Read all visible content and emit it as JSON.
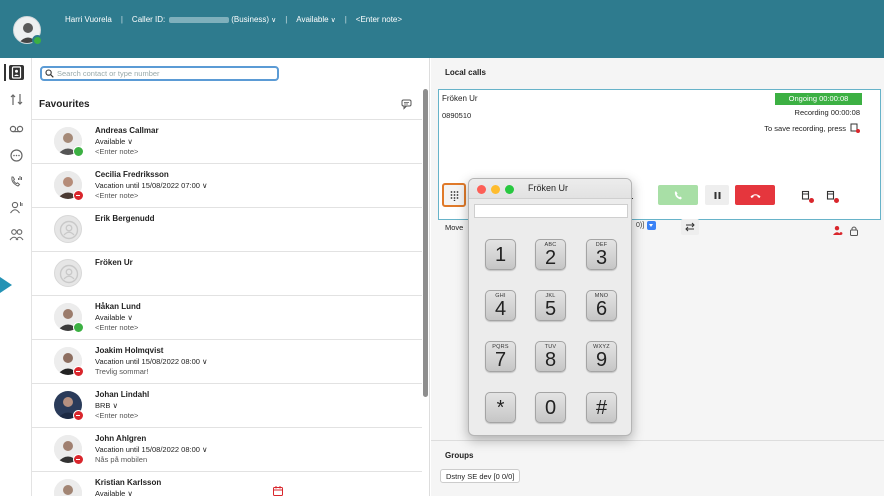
{
  "header": {
    "user_name": "Harri Vuorela",
    "caller_id_label": "Caller ID:",
    "caller_id_suffix": "(Business)",
    "presence": "Available",
    "note_placeholder": "<Enter note>",
    "caret": "∨"
  },
  "search": {
    "placeholder": "Search contact or type number"
  },
  "favourites": {
    "title": "Favourites",
    "contacts": [
      {
        "name": "Andreas Callmar",
        "status": "Available ∨",
        "note": "<Enter note>",
        "presence": "green"
      },
      {
        "name": "Cecilia Fredriksson",
        "status": "Vacation until 15/08/2022 07:00 ∨",
        "note": "<Enter note>",
        "presence": "red"
      },
      {
        "name": "Erik Bergenudd",
        "status": "",
        "note": "",
        "presence": "none"
      },
      {
        "name": "Fröken Ur",
        "status": "",
        "note": "",
        "presence": "none"
      },
      {
        "name": "Håkan Lund",
        "status": "Available ∨",
        "note": "<Enter note>",
        "presence": "green"
      },
      {
        "name": "Joakim Holmqvist",
        "status": "Vacation until 15/08/2022 08:00 ∨",
        "note": "Trevlig sommar!",
        "presence": "red"
      },
      {
        "name": "Johan Lindahl",
        "status": "BRB ∨",
        "note": "<Enter note>",
        "presence": "red"
      },
      {
        "name": "John Ahlgren",
        "status": "Vacation until 15/08/2022 08:00 ∨",
        "note": "Nås på mobilen",
        "presence": "red"
      },
      {
        "name": "Kristian Karlsson",
        "status": "Available ∨",
        "note": "",
        "presence": "green"
      }
    ]
  },
  "local_calls": {
    "title": "Local calls",
    "call": {
      "name": "Fröken Ur",
      "number": "0890510",
      "ongoing": "Ongoing 00:00:08",
      "recording": "Recording 00:00:08",
      "save_recording": "To save recording, press",
      "move_label": "Move",
      "move_select_suffix": "0)]"
    }
  },
  "groups": {
    "title": "Groups",
    "items": [
      "Dstny SE dev [0 0/0]"
    ]
  },
  "keypad": {
    "title": "Fröken Ur",
    "display": "",
    "keys": [
      {
        "digit": "1",
        "letters": ""
      },
      {
        "digit": "2",
        "letters": "ABC"
      },
      {
        "digit": "3",
        "letters": "DEF"
      },
      {
        "digit": "4",
        "letters": "GHI"
      },
      {
        "digit": "5",
        "letters": "JKL"
      },
      {
        "digit": "6",
        "letters": "MNO"
      },
      {
        "digit": "7",
        "letters": "PQRS"
      },
      {
        "digit": "8",
        "letters": "TUV"
      },
      {
        "digit": "9",
        "letters": "WXYZ"
      },
      {
        "digit": "*",
        "letters": ""
      },
      {
        "digit": "0",
        "letters": ""
      },
      {
        "digit": "#",
        "letters": ""
      }
    ]
  },
  "colors": {
    "header_bg": "#2e7b8e",
    "available": "#3cb043",
    "busy": "#d9262c",
    "ongoing": "#3cb043",
    "hangup": "#e5363d",
    "answer": "#a8dfa6"
  }
}
